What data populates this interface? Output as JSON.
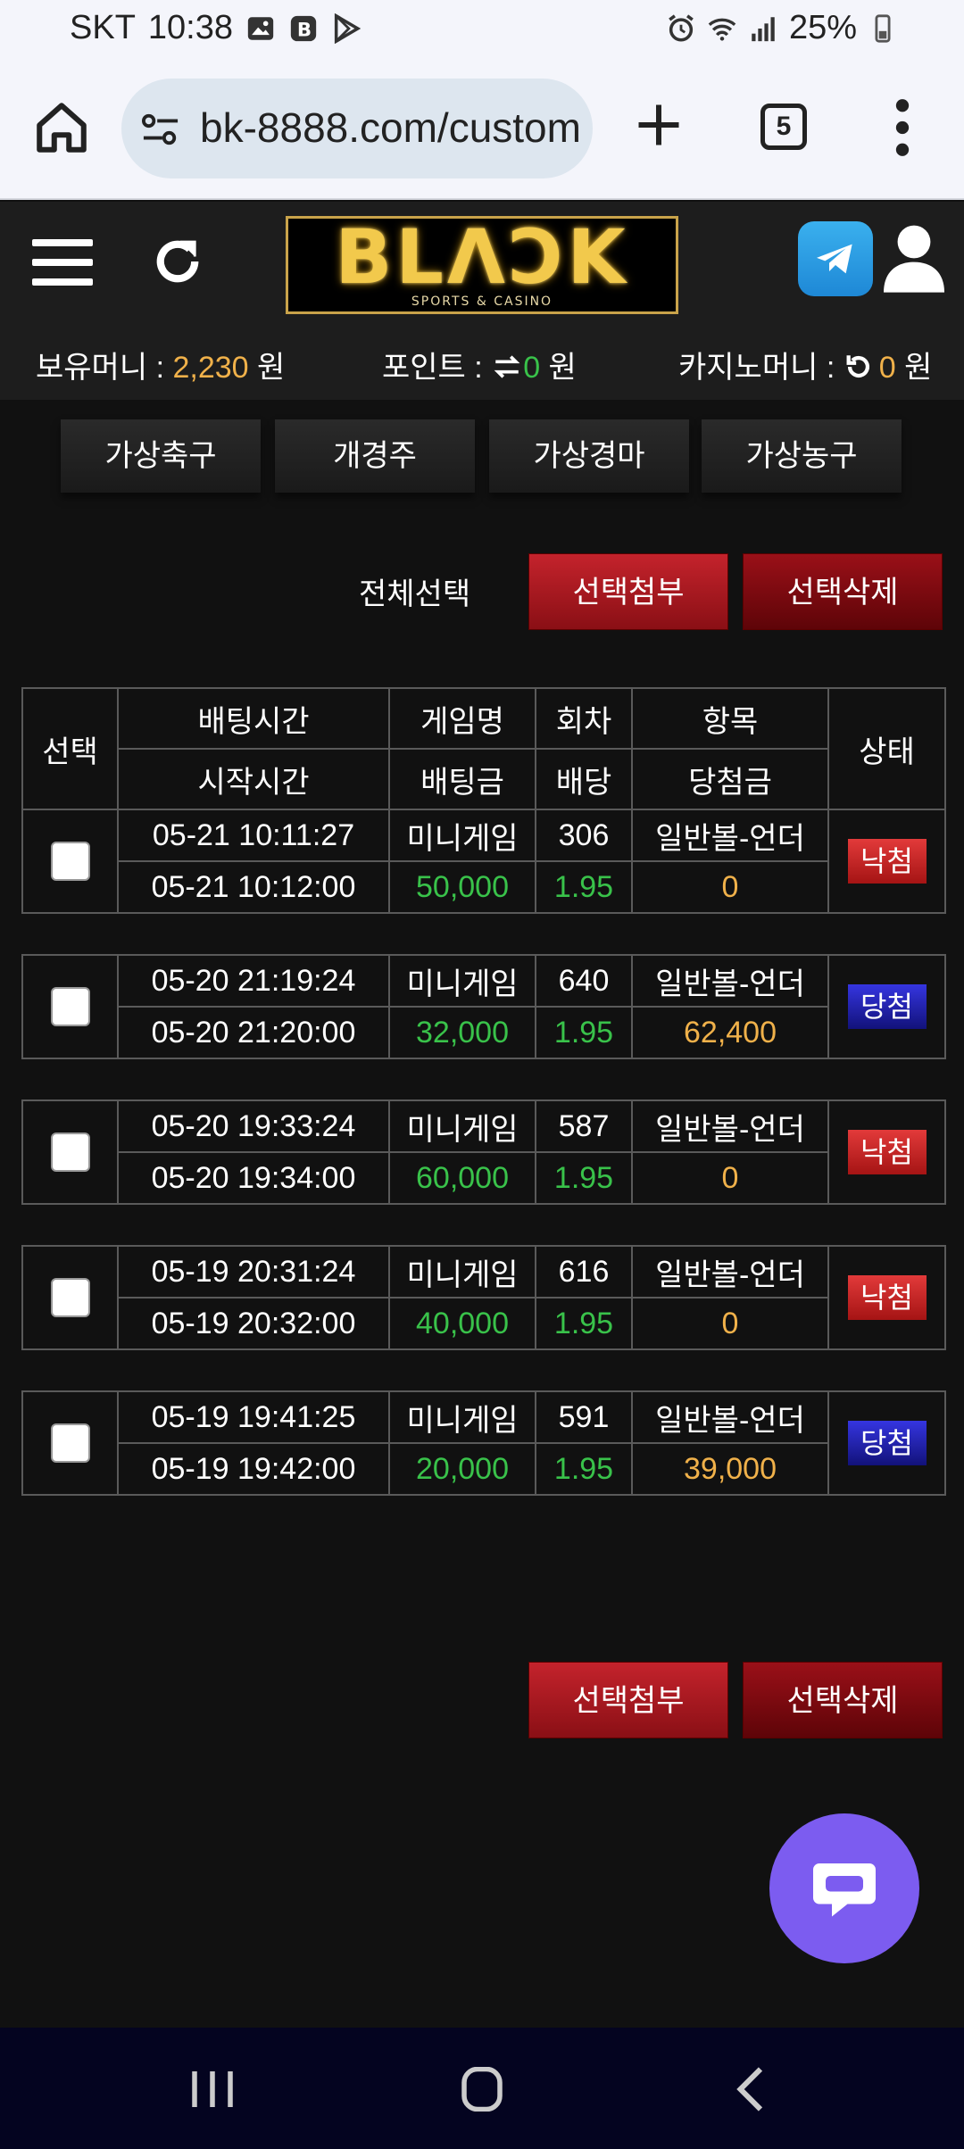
{
  "status_bar": {
    "carrier": "SKT",
    "time": "10:38",
    "battery": "25%"
  },
  "browser": {
    "url": "bk-8888.com/custom",
    "tab_count": "5"
  },
  "logo": {
    "text": "BLΛƆK",
    "sub": "SPORTS & CASINO"
  },
  "balances": {
    "money_label": "보유머니 : ",
    "money_value": "2,230",
    "money_unit": " 원",
    "point_label": "포인트 : ",
    "point_value": "0",
    "point_unit": " 원",
    "casino_label": "카지노머니 : ",
    "casino_value": "0",
    "casino_unit": " 원"
  },
  "game_tabs": [
    "가상축구",
    "개경주",
    "가상경마",
    "가상농구"
  ],
  "actions": {
    "select_all": "전체선택",
    "attach": "선택첨부",
    "delete": "선택삭제"
  },
  "table": {
    "headers": {
      "select": "선택",
      "bet_time": "배팅시간",
      "start_time": "시작시간",
      "game": "게임명",
      "bet_amount": "배팅금",
      "round": "회차",
      "odds": "배당",
      "item": "항목",
      "win_amount": "당첨금",
      "status": "상태"
    },
    "rows": [
      {
        "bet_time": "05-21 10:11:27",
        "start_time": "05-21 10:12:00",
        "game": "미니게임",
        "bet_amount": "50,000",
        "round": "306",
        "odds": "1.95",
        "item": "일반볼-언더",
        "win_amount": "0",
        "status": "낙첨",
        "status_type": "lose"
      },
      {
        "bet_time": "05-20 21:19:24",
        "start_time": "05-20 21:20:00",
        "game": "미니게임",
        "bet_amount": "32,000",
        "round": "640",
        "odds": "1.95",
        "item": "일반볼-언더",
        "win_amount": "62,400",
        "status": "당첨",
        "status_type": "win"
      },
      {
        "bet_time": "05-20 19:33:24",
        "start_time": "05-20 19:34:00",
        "game": "미니게임",
        "bet_amount": "60,000",
        "round": "587",
        "odds": "1.95",
        "item": "일반볼-언더",
        "win_amount": "0",
        "status": "낙첨",
        "status_type": "lose"
      },
      {
        "bet_time": "05-19 20:31:24",
        "start_time": "05-19 20:32:00",
        "game": "미니게임",
        "bet_amount": "40,000",
        "round": "616",
        "odds": "1.95",
        "item": "일반볼-언더",
        "win_amount": "0",
        "status": "낙첨",
        "status_type": "lose"
      },
      {
        "bet_time": "05-19 19:41:25",
        "start_time": "05-19 19:42:00",
        "game": "미니게임",
        "bet_amount": "20,000",
        "round": "591",
        "odds": "1.95",
        "item": "일반볼-언더",
        "win_amount": "39,000",
        "status": "당첨",
        "status_type": "win"
      }
    ]
  },
  "colors": {
    "amount_green": "#39c24a",
    "amount_orange": "#f0b14a",
    "lose_badge": "#c62020",
    "win_badge": "#2424b0",
    "chat": "#7c5cf0"
  }
}
